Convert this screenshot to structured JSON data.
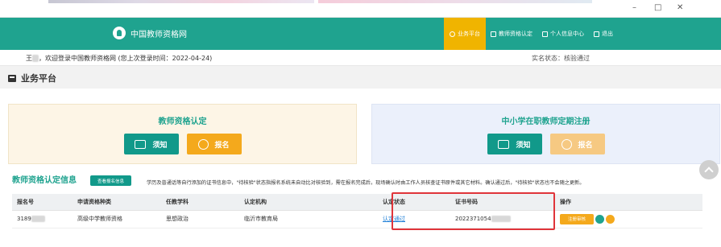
{
  "window": {
    "minimize": "–",
    "maximize": "□",
    "close": "✕"
  },
  "header": {
    "site_title": "中国教师资格网",
    "nav": [
      {
        "label": "业务平台",
        "icon": "home-icon",
        "active": true
      },
      {
        "label": "教师资格认定",
        "icon": "monitor-icon",
        "active": false
      },
      {
        "label": "个人信息中心",
        "icon": "user-icon",
        "active": false
      },
      {
        "label": "退出",
        "icon": "logout-icon",
        "active": false
      }
    ]
  },
  "welcome": {
    "prefix": "王",
    "masked": "**",
    "text": "，欢迎登录中国教师资格网 (您上次登录时间：2022-04-24)",
    "status": "实名状态：核验通过"
  },
  "section_title": "业务平台",
  "cards": [
    {
      "title": "教师资格认定",
      "note_label": "须知",
      "apply_label": "报名"
    },
    {
      "title": "中小学在职教师定期注册",
      "note_label": "须知",
      "apply_label": "报名"
    }
  ],
  "info": {
    "title": "教师资格认定信息",
    "view_button": "查看报名信息",
    "note": "学历及普通话等自行添加的证书信息中，\"待核验\"状态指报名系统未自动比对核验到，需在报名完成后，现场确认时由工作人员核查证书原件或其它材料。确认通过后，\"待核验\"状态也不会随之更新。",
    "columns": [
      "报名号",
      "申请资格种类",
      "任教学科",
      "认定机构",
      "认定状态",
      "证书号码",
      "操作"
    ],
    "rows": [
      {
        "reg_no": "3189",
        "reg_no_masked": "*****",
        "qual_type": "高级中学教师资格",
        "subject": "思想政治",
        "org": "临沂市教育局",
        "status": "认定通过",
        "cert_no": "2022371054",
        "cert_masked": "*******",
        "op_label": "注册审核"
      }
    ]
  },
  "colors": {
    "brand": "#1fa38f",
    "accent": "#f0b400",
    "apply": "#f4a91c",
    "link": "#1e7fd7",
    "highlight": "#e0343a"
  }
}
